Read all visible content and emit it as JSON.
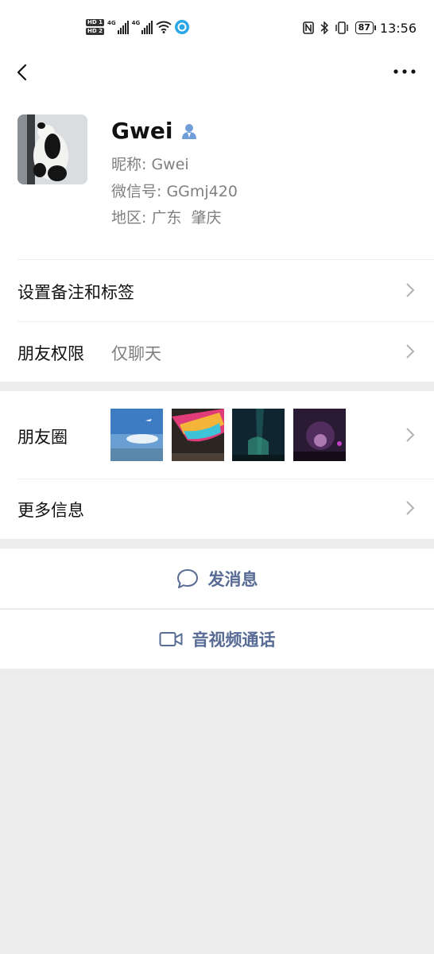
{
  "status_bar": {
    "hd1": "HD 1",
    "hd2": "HD 2",
    "net1": "4G",
    "net2": "4G",
    "battery": "87",
    "time": "13:56"
  },
  "profile": {
    "name": "Gwei",
    "nickname_label": "昵称:",
    "nickname": "Gwei",
    "wechat_id_label": "微信号:",
    "wechat_id": "GGmj420",
    "region_label": "地区:",
    "region": "广东  肇庆"
  },
  "rows": {
    "remark_label": "设置备注和标签",
    "permission_label": "朋友权限",
    "permission_value": "仅聊天",
    "moments_label": "朋友圈",
    "more_info_label": "更多信息"
  },
  "actions": {
    "message_label": "发消息",
    "video_call_label": "音视频通话"
  },
  "colors": {
    "link": "#576b95",
    "verified_icon": "#6f9ed8"
  }
}
